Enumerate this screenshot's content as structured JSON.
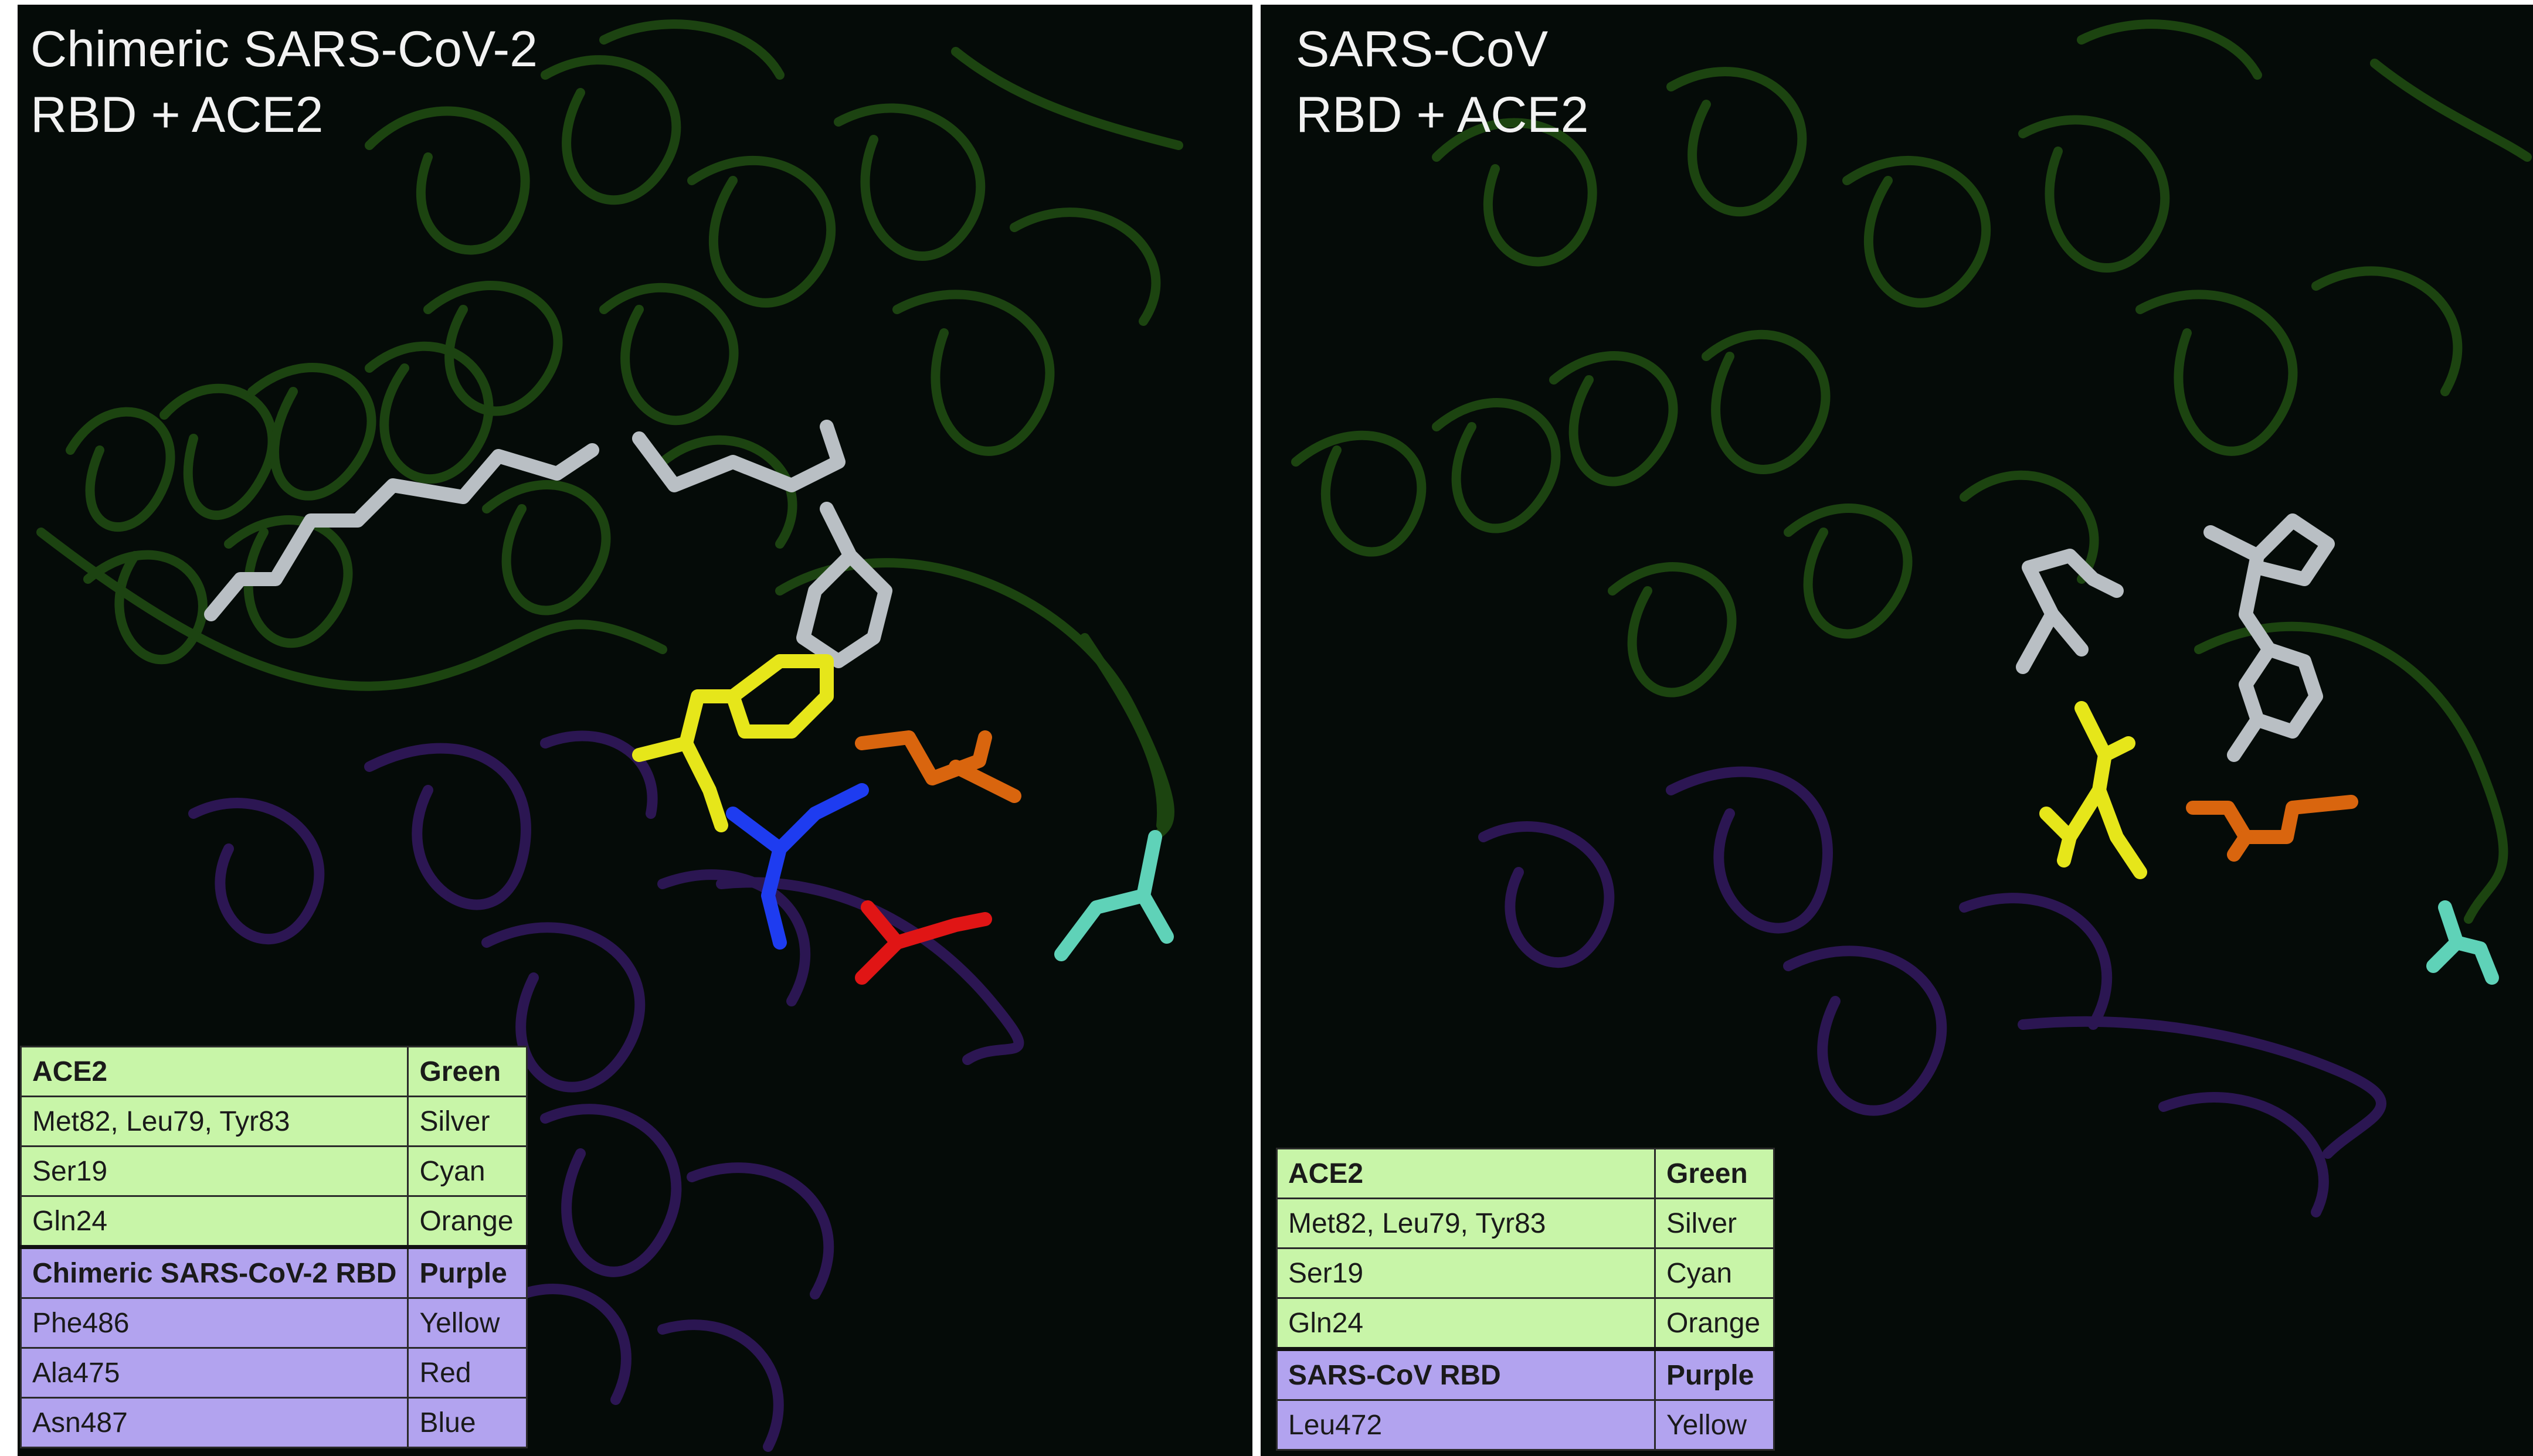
{
  "left_panel": {
    "title_line1": "Chimeric SARS-CoV-2",
    "title_line2": "RBD + ACE2",
    "legend": [
      {
        "residue": "ACE2",
        "color": "Green",
        "group": "ace",
        "header": true
      },
      {
        "residue": "Met82, Leu79, Tyr83",
        "color": "Silver",
        "group": "ace",
        "header": false
      },
      {
        "residue": "Ser19",
        "color": "Cyan",
        "group": "ace",
        "header": false
      },
      {
        "residue": "Gln24",
        "color": "Orange",
        "group": "ace",
        "header": false
      },
      {
        "residue": "Chimeric SARS-CoV-2 RBD",
        "color": "Purple",
        "group": "rbd",
        "header": true
      },
      {
        "residue": "Phe486",
        "color": "Yellow",
        "group": "rbd",
        "header": false
      },
      {
        "residue": "Ala475",
        "color": "Red",
        "group": "rbd",
        "header": false
      },
      {
        "residue": "Asn487",
        "color": "Blue",
        "group": "rbd",
        "header": false
      }
    ]
  },
  "right_panel": {
    "title_line1": "SARS-CoV",
    "title_line2": "RBD + ACE2",
    "legend": [
      {
        "residue": "ACE2",
        "color": "Green",
        "group": "ace",
        "header": true
      },
      {
        "residue": "Met82, Leu79, Tyr83",
        "color": "Silver",
        "group": "ace",
        "header": false
      },
      {
        "residue": "Ser19",
        "color": "Cyan",
        "group": "ace",
        "header": false
      },
      {
        "residue": "Gln24",
        "color": "Orange",
        "group": "ace",
        "header": false
      },
      {
        "residue": "SARS-CoV RBD",
        "color": "Purple",
        "group": "rbd",
        "header": true
      },
      {
        "residue": "Leu472",
        "color": "Yellow",
        "group": "rbd",
        "header": false
      }
    ]
  },
  "colors": {
    "background": "#050b08",
    "ace2_ribbon": "#1f4a12",
    "rbd_ribbon": "#2e1757",
    "silver": "#b9bfc4",
    "cyan": "#5fd2b8",
    "orange": "#d9650e",
    "yellow": "#e6e61a",
    "red": "#e01515",
    "blue": "#1e3cf0"
  }
}
